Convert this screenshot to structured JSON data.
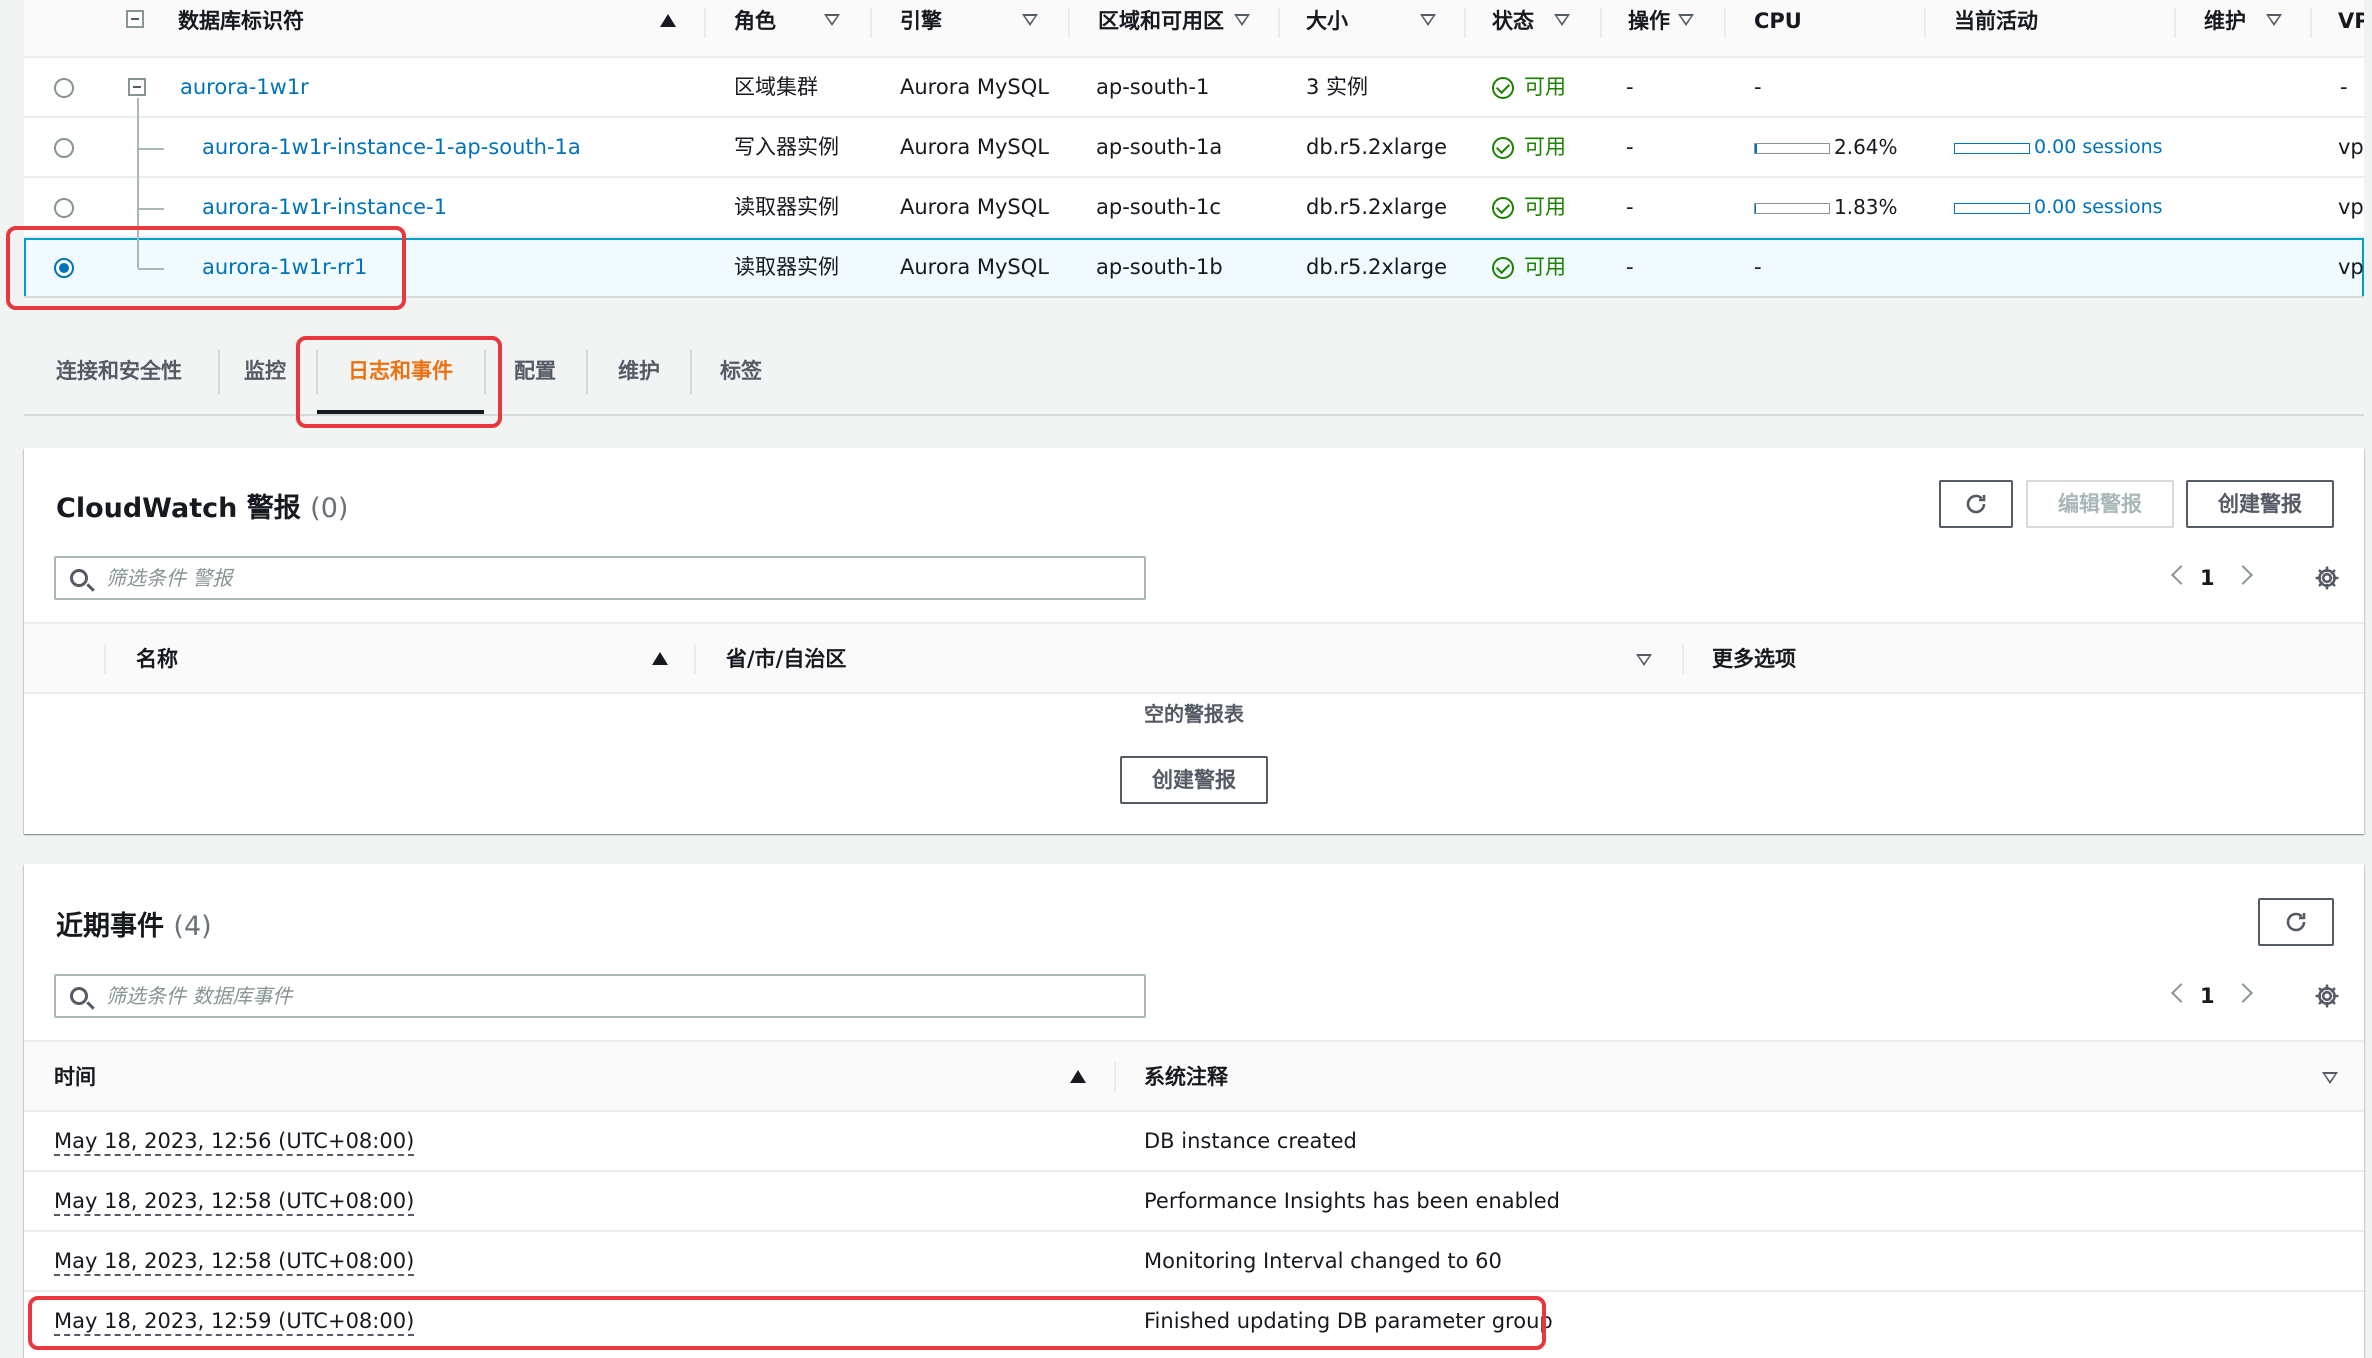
{
  "db_table": {
    "headers": {
      "identifier": "数据库标识符",
      "role": "角色",
      "engine": "引擎",
      "region": "区域和可用区",
      "size": "大小",
      "status": "状态",
      "actions": "操作",
      "cpu": "CPU",
      "activity": "当前活动",
      "maintenance": "维护",
      "vpc": "VP"
    },
    "rows": [
      {
        "identifier": "aurora-1w1r",
        "role": "区域集群",
        "engine": "Aurora MySQL",
        "region": "ap-south-1",
        "size": "3 实例",
        "status": "可用",
        "actions": "-",
        "cpu": "-",
        "cpu_pct": null,
        "activity": "",
        "activity_pct": null,
        "maintenance": "-",
        "vpc": "",
        "selected": false
      },
      {
        "identifier": "aurora-1w1r-instance-1-ap-south-1a",
        "role": "写入器实例",
        "engine": "Aurora MySQL",
        "region": "ap-south-1a",
        "size": "db.r5.2xlarge",
        "status": "可用",
        "actions": "-",
        "cpu": "2.64%",
        "cpu_pct": 2.64,
        "activity": "0.00 sessions",
        "activity_pct": 0,
        "maintenance": "",
        "vpc": "vpc",
        "selected": false
      },
      {
        "identifier": "aurora-1w1r-instance-1",
        "role": "读取器实例",
        "engine": "Aurora MySQL",
        "region": "ap-south-1c",
        "size": "db.r5.2xlarge",
        "status": "可用",
        "actions": "-",
        "cpu": "1.83%",
        "cpu_pct": 1.83,
        "activity": "0.00 sessions",
        "activity_pct": 0,
        "maintenance": "",
        "vpc": "vpc",
        "selected": false
      },
      {
        "identifier": "aurora-1w1r-rr1",
        "role": "读取器实例",
        "engine": "Aurora MySQL",
        "region": "ap-south-1b",
        "size": "db.r5.2xlarge",
        "status": "可用",
        "actions": "-",
        "cpu": "-",
        "cpu_pct": null,
        "activity": "",
        "activity_pct": null,
        "maintenance": "",
        "vpc": "vpc",
        "selected": true
      }
    ]
  },
  "tabs": [
    {
      "label": "连接和安全性",
      "active": false
    },
    {
      "label": "监控",
      "active": false
    },
    {
      "label": "日志和事件",
      "active": true
    },
    {
      "label": "配置",
      "active": false
    },
    {
      "label": "维护",
      "active": false
    },
    {
      "label": "标签",
      "active": false
    }
  ],
  "alarms": {
    "title": "CloudWatch 警报",
    "count": "(0)",
    "edit_button": "编辑警报",
    "create_button": "创建警报",
    "search_placeholder": "筛选条件 警报",
    "page": "1",
    "columns": {
      "name": "名称",
      "region": "省/市/自治区",
      "more": "更多选项"
    },
    "empty_text": "空的警报表",
    "empty_create_button": "创建警报"
  },
  "events": {
    "title": "近期事件",
    "count": "(4)",
    "search_placeholder": "筛选条件 数据库事件",
    "page": "1",
    "columns": {
      "time": "时间",
      "note": "系统注释"
    },
    "rows": [
      {
        "time": "May 18, 2023, 12:56 (UTC+08:00)",
        "note": "DB instance created"
      },
      {
        "time": "May 18, 2023, 12:58 (UTC+08:00)",
        "note": "Performance Insights has been enabled"
      },
      {
        "time": "May 18, 2023, 12:58 (UTC+08:00)",
        "note": "Monitoring Interval changed to 60"
      },
      {
        "time": "May 18, 2023, 12:59 (UTC+08:00)",
        "note": "Finished updating DB parameter group"
      }
    ]
  },
  "colors": {
    "accent_orange": "#ec7211",
    "link_blue": "#0073bb",
    "status_green": "#1d8102",
    "highlight_red": "#e8373d"
  },
  "icons": [
    "search-icon",
    "refresh-icon",
    "settings-icon",
    "chevron-left-icon",
    "chevron-right-icon",
    "status-available-icon",
    "sort-ascending-icon",
    "sort-descending-icon",
    "collapse-icon"
  ]
}
